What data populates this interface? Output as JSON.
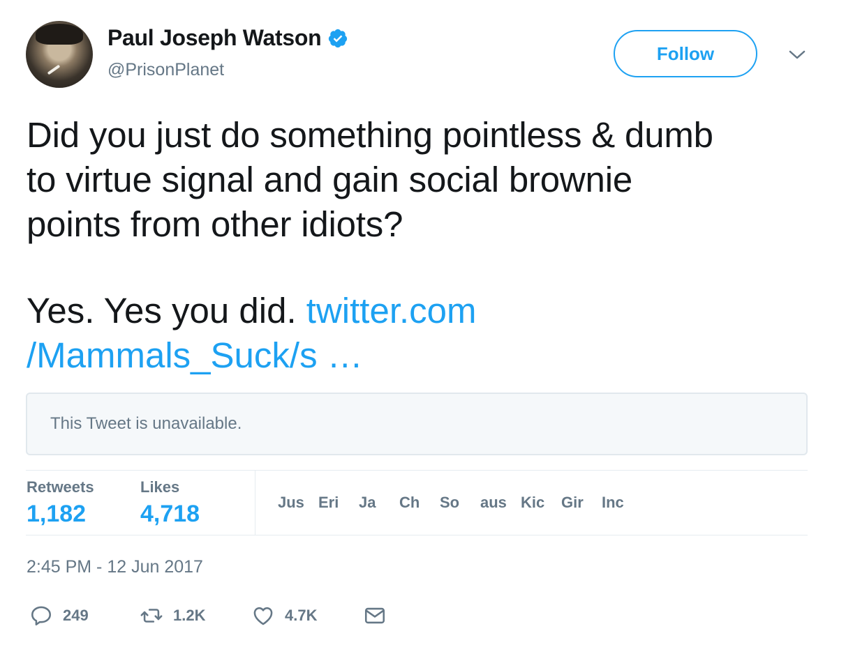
{
  "author": {
    "name": "Paul Joseph Watson",
    "handle": "@PrisonPlanet",
    "verified": true
  },
  "follow_label": "Follow",
  "tweet": {
    "lines": [
      "Did you just do something pointless & dumb",
      "to virtue signal and gain social brownie",
      "points from other idiots?"
    ],
    "answer": "Yes. Yes you did.",
    "link_line1": "twitter.com",
    "link_line2": "/Mammals_Suck/s …"
  },
  "quoted_tweet_notice": "This Tweet is unavailable.",
  "stats": {
    "retweets_label": "Retweets",
    "retweets_value": "1,182",
    "likes_label": "Likes",
    "likes_value": "4,718"
  },
  "likers": [
    "Jus",
    "Eri",
    "Ja",
    "Ch",
    "So",
    "aus",
    "Kic",
    "Gir",
    "Inc"
  ],
  "timestamp": "2:45 PM - 12 Jun 2017",
  "actions": {
    "replies": "249",
    "retweets": "1.2K",
    "likes": "4.7K"
  },
  "colors": {
    "accent": "#1da1f2",
    "muted": "#657786",
    "text": "#14171a"
  }
}
